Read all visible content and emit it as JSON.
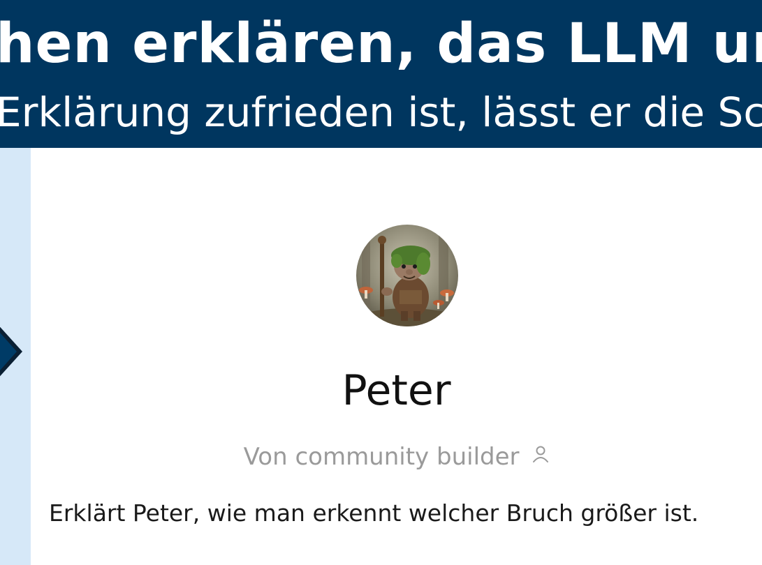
{
  "banner": {
    "title": "hen erklären, das LLM unt",
    "subtitle": "Erklärung zufrieden ist, lässt er die Sc"
  },
  "profile": {
    "name": "Peter",
    "author": "Von community builder",
    "author_icon": "user-icon",
    "description": "Erklärt Peter, wie man erkennt welcher Bruch größer ist."
  },
  "colors": {
    "banner_bg": "#00365f",
    "side_strip": "#d6e8f8",
    "arrow": "#003b66"
  }
}
